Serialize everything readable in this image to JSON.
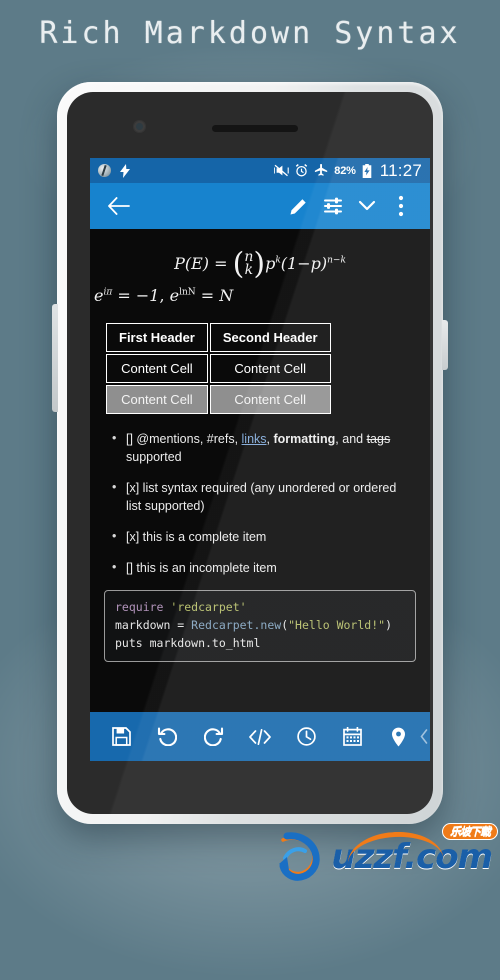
{
  "headline": "Rich Markdown Syntax",
  "statusbar": {
    "left_icons": [
      "app-circle-icon",
      "flash-icon"
    ],
    "right_icons": [
      "vibrate-off-icon",
      "alarm-icon",
      "airplane-mode-icon"
    ],
    "battery_percent": "82%",
    "battery_icon": "battery-charging-icon",
    "clock": "11:27"
  },
  "actionbar": {
    "back": "back-arrow-icon",
    "edit": "pencil-icon",
    "tune": "tune-sliders-icon",
    "chevron": "chevron-down-icon",
    "overflow": "more-vertical-icon"
  },
  "math": {
    "formula_1_plain": "P(E) = (n k) p^k (1-p)^(n-k)",
    "formula_1": {
      "lhs": "P(E)",
      "eq": "=",
      "binom_top": "n",
      "binom_bottom": "k",
      "p": "p",
      "k": "k",
      "one_minus_p": "(1",
      "minus": "−",
      "p2": "p)",
      "exp_nk": "n−k"
    },
    "formula_2_plain": "e^{iπ} = −1 , e^{lnN} = N",
    "formula_2": {
      "e1": "e",
      "ipi": "iπ",
      "eq1": "=",
      "minus_one": "−1",
      "comma": ",",
      "e2": "e",
      "lnN": "lnN",
      "eq2": "=",
      "N": "N"
    }
  },
  "table": {
    "headers": [
      "First Header",
      "Second Header"
    ],
    "rows": [
      {
        "cells": [
          "Content Cell",
          "Content Cell"
        ],
        "alt": false
      },
      {
        "cells": [
          "Content Cell",
          "Content Cell"
        ],
        "alt": true
      }
    ]
  },
  "list": {
    "item1": {
      "prefix": "[] @mentions, #refs, ",
      "link": "links",
      "mid": ", ",
      "bold": "formatting",
      "mid2": ", and ",
      "strike": "tags",
      "suffix": " supported"
    },
    "item2": "[x] list syntax required (any unordered or ordered list supported)",
    "item3": "[x] this is a complete item",
    "item4": "[] this is an incomplete item"
  },
  "code": {
    "language": "ruby",
    "line1_kw": "require",
    "line1_str": " 'redcarpet'",
    "line2_a": "markdown = ",
    "line2_cls": "Redcarpet.new",
    "line2_b": "(",
    "line2_str": "\"Hello World!\"",
    "line2_c": ")",
    "line3": "puts markdown.to_html",
    "colors": {
      "keyword": "#b294bb",
      "string": "#b5bd68",
      "class": "#81a2be",
      "text": "#e6e6e6",
      "background": "#111213"
    }
  },
  "bottombar": {
    "items": [
      {
        "name": "save-icon",
        "label": "Save"
      },
      {
        "name": "undo-icon",
        "label": "Undo"
      },
      {
        "name": "redo-icon",
        "label": "Redo"
      },
      {
        "name": "code-icon",
        "label": "Code"
      },
      {
        "name": "clock-icon",
        "label": "Time"
      },
      {
        "name": "calendar-icon",
        "label": "Date"
      },
      {
        "name": "location-pin-icon",
        "label": "Location"
      }
    ]
  },
  "watermark": {
    "text": "uzzf",
    "domain": ".com",
    "badge": "乐坡下载"
  },
  "colors": {
    "background": "#5d7b88",
    "statusbar": "#1565a8",
    "actionbar": "#1783ce",
    "bottombar": "#1769ad",
    "screen": "#0a0a0a",
    "link": "#7fa8d8",
    "accent_orange": "#f07b18",
    "brand_blue": "#1a5fa8"
  }
}
